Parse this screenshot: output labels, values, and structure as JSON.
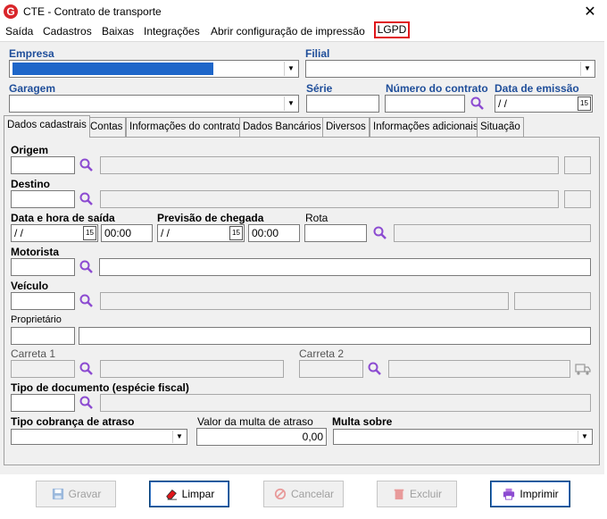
{
  "window": {
    "title": "CTE - Contrato de transporte",
    "close_symbol": "✕"
  },
  "menu": {
    "saida": "Saída",
    "cadastros": "Cadastros",
    "baixas": "Baixas",
    "integracoes": "Integrações",
    "abrir": "Abrir configuração de impressão",
    "lgpd": "LGPD"
  },
  "header": {
    "empresa_label": "Empresa",
    "filial_label": "Filial",
    "garagem_label": "Garagem",
    "serie_label": "Série",
    "numero_label": "Número do contrato",
    "data_emissao_label": "Data de emissão",
    "data_emissao_value": " / /"
  },
  "tabs": [
    "Dados cadastrais",
    "Contas",
    "Informações do contrato",
    "Dados Bancários",
    "Diversos",
    "Informações adicionais",
    "Situação"
  ],
  "form": {
    "origem_label": "Origem",
    "destino_label": "Destino",
    "data_saida_label": "Data e hora de saída",
    "data_saida_value": " / /",
    "hora_saida_value": "00:00",
    "previsao_label": "Previsão de chegada",
    "previsao_value": " / /",
    "hora_chegada_value": "00:00",
    "rota_label": "Rota",
    "motorista_label": "Motorista",
    "veiculo_label": "Veículo",
    "proprietario_label": "Proprietário",
    "carreta1_label": "Carreta 1",
    "carreta2_label": "Carreta 2",
    "tipo_doc_label": "Tipo de documento (espécie fiscal)",
    "tipo_cobranca_label": "Tipo cobrança de atraso",
    "valor_multa_label": "Valor da multa de atraso",
    "valor_multa_value": "0,00",
    "multa_sobre_label": "Multa sobre"
  },
  "buttons": {
    "gravar": "Gravar",
    "limpar": "Limpar",
    "cancelar": "Cancelar",
    "excluir": "Excluir",
    "imprimir": "Imprimir"
  },
  "colors": {
    "accent": "#1f4e9a",
    "lgpd_border": "#e0161b",
    "logo": "#d9262b",
    "search_icon": "#8c4bd1"
  }
}
